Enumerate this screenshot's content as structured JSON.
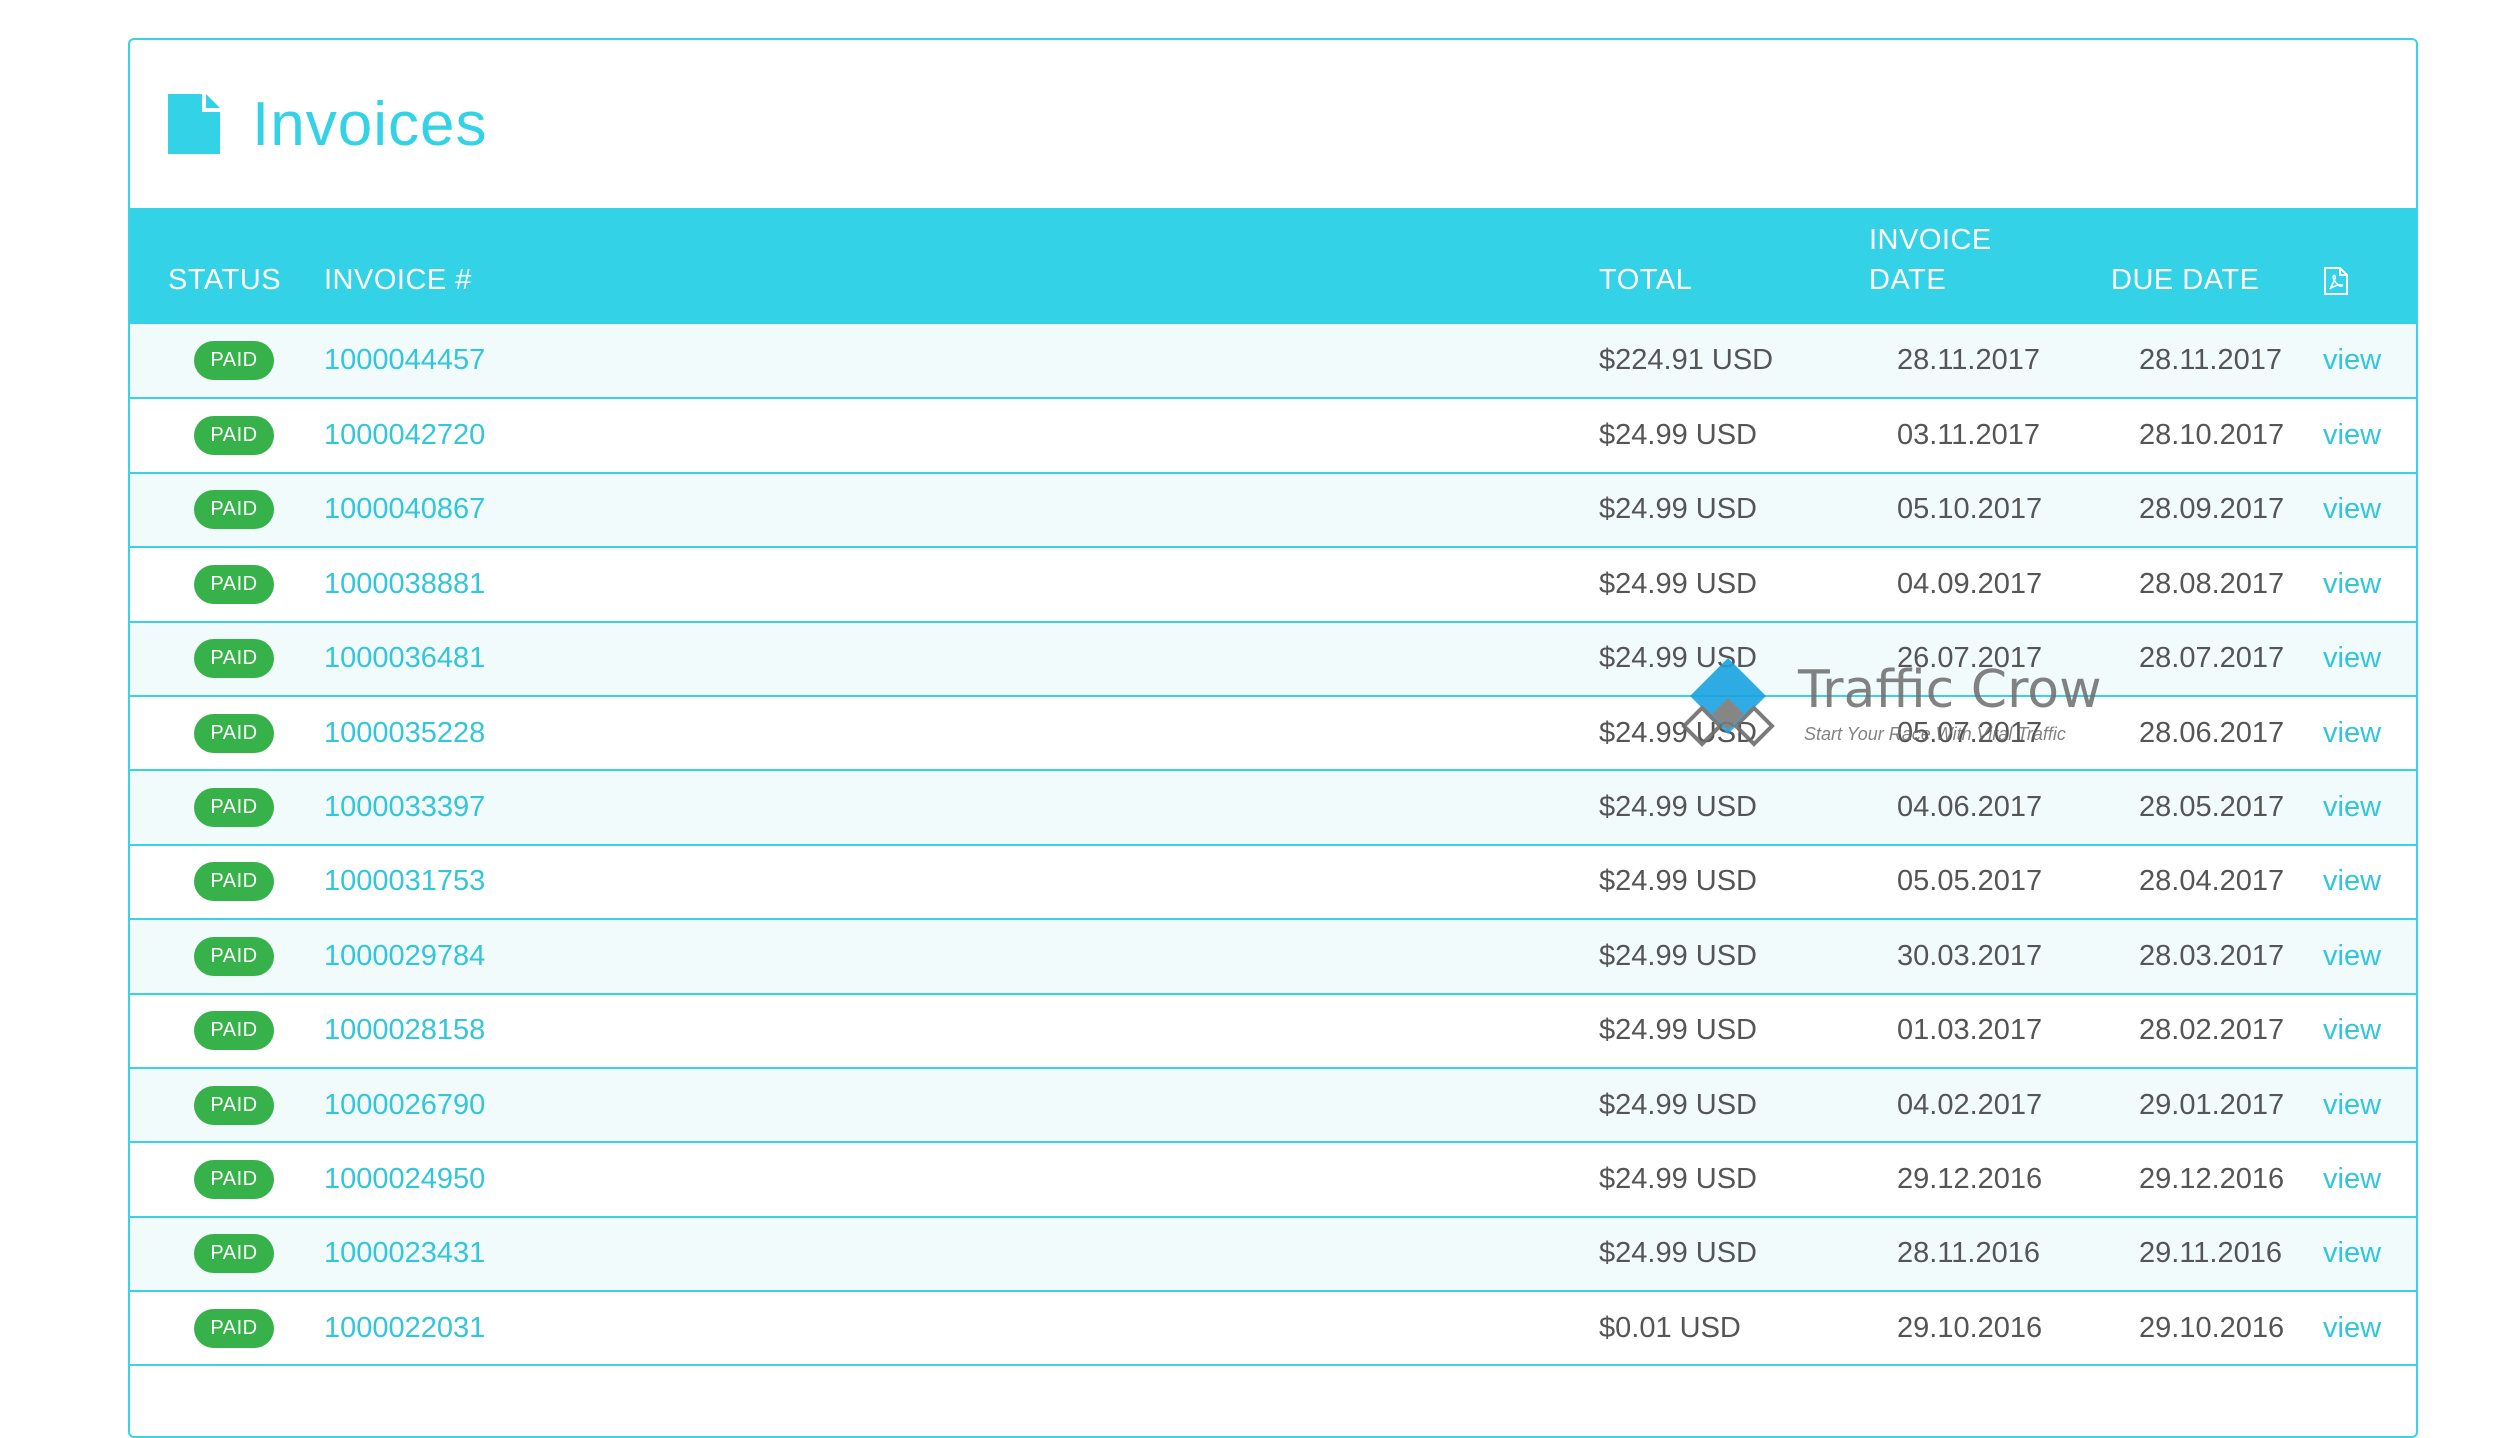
{
  "page": {
    "title": "Invoices",
    "icon": "document-icon"
  },
  "colors": {
    "accent": "#33d2e6",
    "paid": "#37b24a",
    "link": "#33c6da"
  },
  "table": {
    "headers": {
      "status": "STATUS",
      "invoice": "INVOICE #",
      "total": "TOTAL",
      "invoice_date_1": "INVOICE",
      "invoice_date_2": "DATE",
      "due_date": "DUE DATE",
      "pdf_icon": "pdf-icon"
    },
    "rows": [
      {
        "status": "PAID",
        "invoice": "1000044457",
        "total": "$224.91 USD",
        "invoice_date": "28.11.2017",
        "due_date": "28.11.2017",
        "action": "view"
      },
      {
        "status": "PAID",
        "invoice": "1000042720",
        "total": "$24.99 USD",
        "invoice_date": "03.11.2017",
        "due_date": "28.10.2017",
        "action": "view"
      },
      {
        "status": "PAID",
        "invoice": "1000040867",
        "total": "$24.99 USD",
        "invoice_date": "05.10.2017",
        "due_date": "28.09.2017",
        "action": "view"
      },
      {
        "status": "PAID",
        "invoice": "1000038881",
        "total": "$24.99 USD",
        "invoice_date": "04.09.2017",
        "due_date": "28.08.2017",
        "action": "view"
      },
      {
        "status": "PAID",
        "invoice": "1000036481",
        "total": "$24.99 USD",
        "invoice_date": "26.07.2017",
        "due_date": "28.07.2017",
        "action": "view"
      },
      {
        "status": "PAID",
        "invoice": "1000035228",
        "total": "$24.99 USD",
        "invoice_date": "05.07.2017",
        "due_date": "28.06.2017",
        "action": "view"
      },
      {
        "status": "PAID",
        "invoice": "1000033397",
        "total": "$24.99 USD",
        "invoice_date": "04.06.2017",
        "due_date": "28.05.2017",
        "action": "view"
      },
      {
        "status": "PAID",
        "invoice": "1000031753",
        "total": "$24.99 USD",
        "invoice_date": "05.05.2017",
        "due_date": "28.04.2017",
        "action": "view"
      },
      {
        "status": "PAID",
        "invoice": "1000029784",
        "total": "$24.99 USD",
        "invoice_date": "30.03.2017",
        "due_date": "28.03.2017",
        "action": "view"
      },
      {
        "status": "PAID",
        "invoice": "1000028158",
        "total": "$24.99 USD",
        "invoice_date": "01.03.2017",
        "due_date": "28.02.2017",
        "action": "view"
      },
      {
        "status": "PAID",
        "invoice": "1000026790",
        "total": "$24.99 USD",
        "invoice_date": "04.02.2017",
        "due_date": "29.01.2017",
        "action": "view"
      },
      {
        "status": "PAID",
        "invoice": "1000024950",
        "total": "$24.99 USD",
        "invoice_date": "29.12.2016",
        "due_date": "29.12.2016",
        "action": "view"
      },
      {
        "status": "PAID",
        "invoice": "1000023431",
        "total": "$24.99 USD",
        "invoice_date": "28.11.2016",
        "due_date": "29.11.2016",
        "action": "view"
      },
      {
        "status": "PAID",
        "invoice": "1000022031",
        "total": "$0.01 USD",
        "invoice_date": "29.10.2016",
        "due_date": "29.10.2016",
        "action": "view"
      }
    ]
  },
  "watermark": {
    "name": "Traffic Crow",
    "tagline": "Start Your Race With Viral Traffic"
  }
}
